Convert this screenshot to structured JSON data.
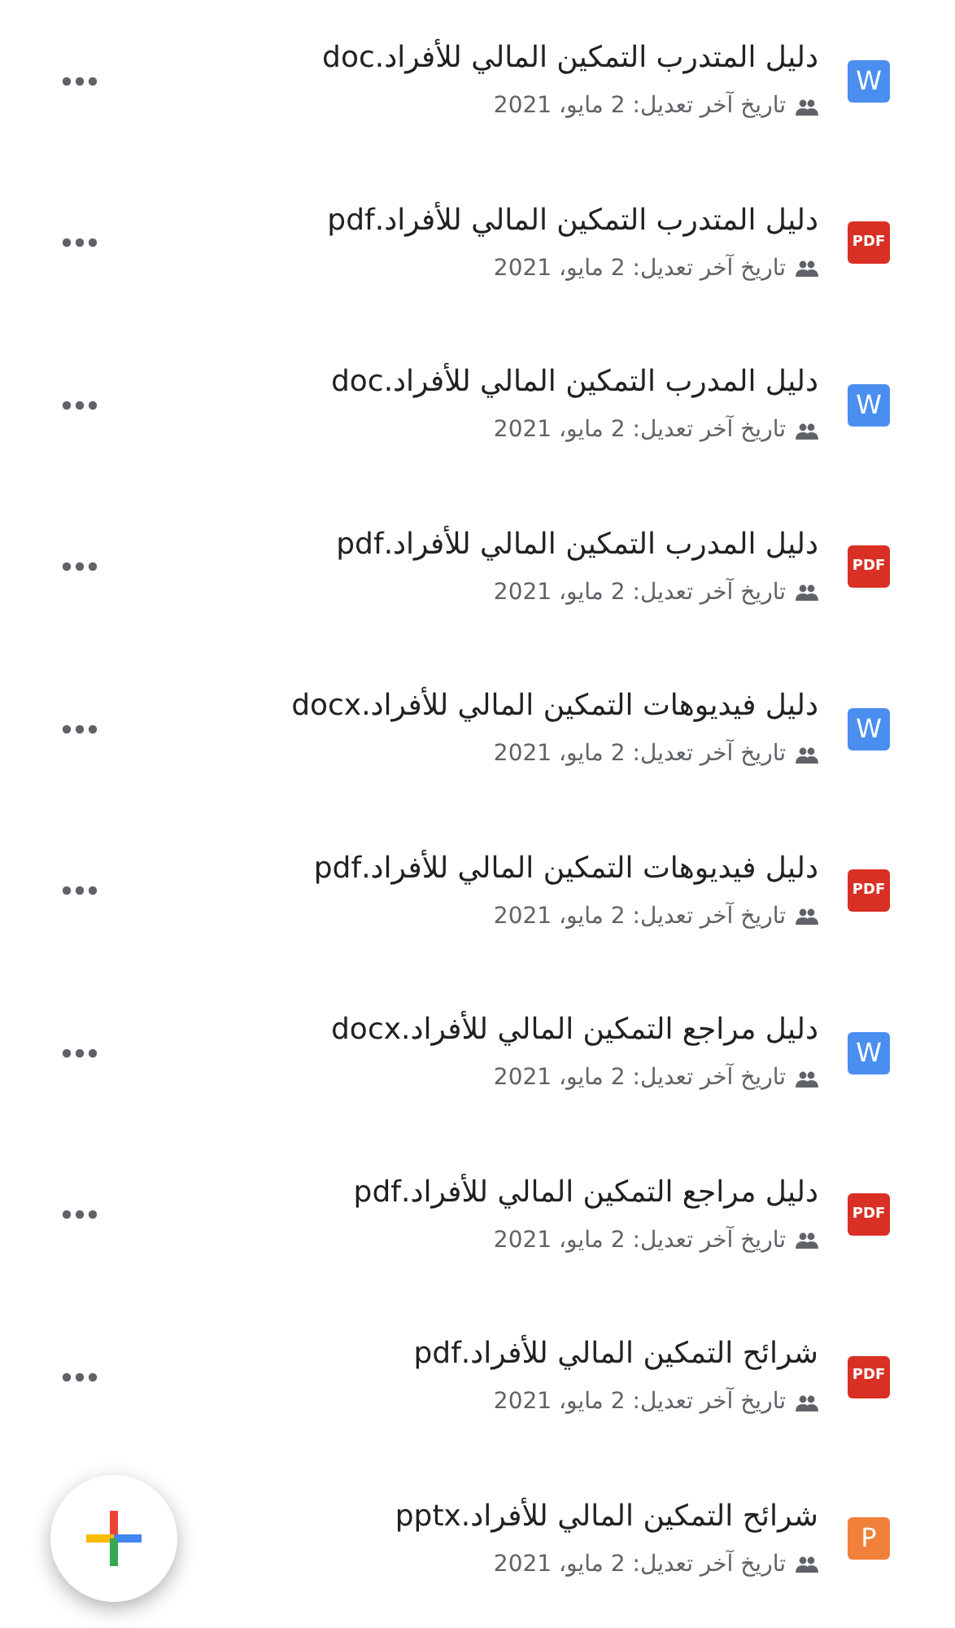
{
  "files": [
    {
      "kind": "word",
      "badge": "W",
      "name": "دليل المتدرب التمكين المالي للأفراد.doc",
      "modified": "تاريخ آخر تعديل: 2 مايو، 2021",
      "shared": true
    },
    {
      "kind": "pdf",
      "badge": "PDF",
      "name": "دليل المتدرب التمكين المالي للأفراد.pdf",
      "modified": "تاريخ آخر تعديل: 2 مايو، 2021",
      "shared": true
    },
    {
      "kind": "word",
      "badge": "W",
      "name": "دليل المدرب التمكين المالي للأفراد.doc",
      "modified": "تاريخ آخر تعديل: 2 مايو، 2021",
      "shared": true
    },
    {
      "kind": "pdf",
      "badge": "PDF",
      "name": "دليل المدرب التمكين المالي للأفراد.pdf",
      "modified": "تاريخ آخر تعديل: 2 مايو، 2021",
      "shared": true
    },
    {
      "kind": "word",
      "badge": "W",
      "name": "دليل فيديوهات التمكين المالي للأفراد.docx",
      "modified": "تاريخ آخر تعديل: 2 مايو، 2021",
      "shared": true
    },
    {
      "kind": "pdf",
      "badge": "PDF",
      "name": "دليل فيديوهات التمكين المالي للأفراد.pdf",
      "modified": "تاريخ آخر تعديل: 2 مايو، 2021",
      "shared": true
    },
    {
      "kind": "word",
      "badge": "W",
      "name": "دليل مراجع التمكين المالي للأفراد.docx",
      "modified": "تاريخ آخر تعديل: 2 مايو، 2021",
      "shared": true
    },
    {
      "kind": "pdf",
      "badge": "PDF",
      "name": "دليل مراجع التمكين المالي للأفراد.pdf",
      "modified": "تاريخ آخر تعديل: 2 مايو، 2021",
      "shared": true
    },
    {
      "kind": "pdf",
      "badge": "PDF",
      "name": "شرائح التمكين المالي للأفراد.pdf",
      "modified": "تاريخ آخر تعديل: 2 مايو، 2021",
      "shared": true
    },
    {
      "kind": "slides",
      "badge": "P",
      "name": "شرائح التمكين المالي للأفراد.pptx",
      "modified": "تاريخ آخر تعديل: 2 مايو، 2021",
      "shared": true,
      "menu": false
    }
  ]
}
